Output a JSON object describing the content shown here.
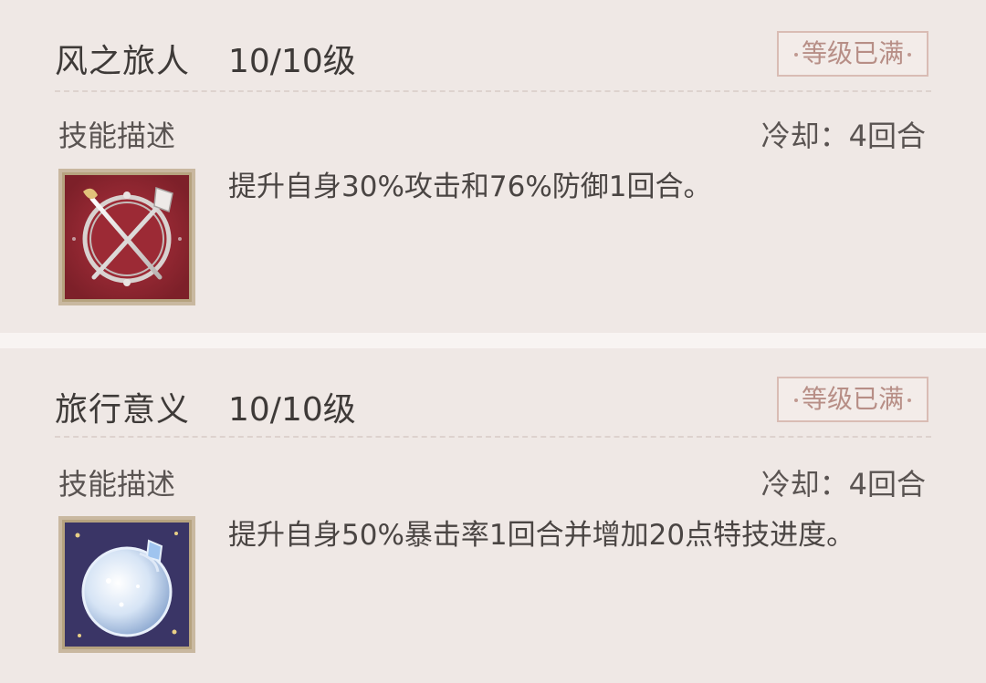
{
  "skills": [
    {
      "name": "风之旅人",
      "level": "10/10级",
      "badge": "等级已满",
      "desc_title": "技能描述",
      "cooldown": "冷却：4回合",
      "description": "提升自身30%攻击和76%防御1回合。",
      "icon": "crossed-sword-axe-icon"
    },
    {
      "name": "旅行意义",
      "level": "10/10级",
      "badge": "等级已满",
      "desc_title": "技能描述",
      "cooldown": "冷却：4回合",
      "description": "提升自身50%暴击率1回合并增加20点特技进度。",
      "icon": "crystal-orb-icon"
    }
  ],
  "colors": {
    "card_bg": "#efe8e5",
    "badge_border": "#d9bcb4",
    "badge_text": "#b78e86",
    "icon1_bg": "#8f2a33",
    "icon2_bg": "#3a3566"
  }
}
